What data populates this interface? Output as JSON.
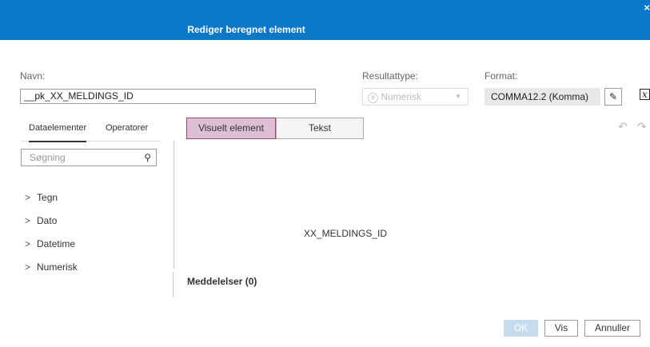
{
  "dialog": {
    "title": "Rediger beregnet element",
    "close": "×"
  },
  "fields": {
    "name_label": "Navn:",
    "name_value": "__pk_XX_MELDINGS_ID",
    "result_label": "Resultattype:",
    "result_value": "Numerisk",
    "result_icon": "#",
    "format_label": "Format:",
    "format_value": "COMMA12.2 (Komma)"
  },
  "left_panel": {
    "tabs": [
      "Dataelementer",
      "Operatorer"
    ],
    "search_placeholder": "Søgning",
    "tree": [
      "Tegn",
      "Dato",
      "Datetime",
      "Numerisk"
    ]
  },
  "editor": {
    "mode_visual": "Visuelt element",
    "mode_text": "Tekst",
    "expression": "XX_MELDINGS_ID",
    "messages": "Meddelelser (0)"
  },
  "footer": {
    "ok": "OK",
    "view": "Vis",
    "cancel": "Annuller"
  },
  "colors": {
    "header": "#0a78c8",
    "active_mode": "#dcbfd3"
  }
}
